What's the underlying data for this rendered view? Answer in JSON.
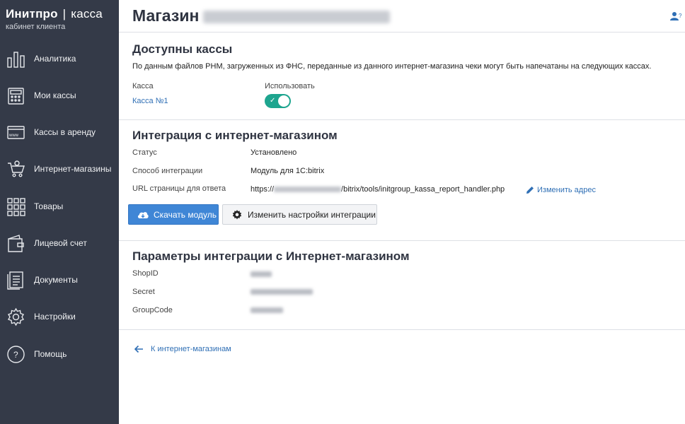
{
  "brand": {
    "name": "Инитпро",
    "separator": "|",
    "product": "касса",
    "subtitle": "кабинет клиента"
  },
  "sidebar": {
    "items": [
      {
        "label": "Аналитика",
        "icon": "bar-chart-icon"
      },
      {
        "label": "Мои кассы",
        "icon": "cash-register-icon"
      },
      {
        "label": "Кассы в аренду",
        "icon": "www-icon"
      },
      {
        "label": "Интернет-магазины",
        "icon": "shopping-cart-icon"
      },
      {
        "label": "Товары",
        "icon": "grid-icon"
      },
      {
        "label": "Лицевой счет",
        "icon": "wallet-icon"
      },
      {
        "label": "Документы",
        "icon": "documents-icon"
      },
      {
        "label": "Настройки",
        "icon": "gear-icon"
      },
      {
        "label": "Помощь",
        "icon": "help-circle-icon"
      }
    ]
  },
  "header": {
    "title": "Магазин"
  },
  "registers": {
    "title": "Доступны кассы",
    "description": "По данным файлов РНМ, загруженных из ФНС, переданные из данного интернет-магазина чеки могут быть напечатаны на следующих кассах.",
    "col_register": "Касса",
    "col_use": "Использовать",
    "register_name": "Касса №1",
    "use_enabled": true
  },
  "integration": {
    "title": "Интеграция с интернет-магазином",
    "status_label": "Статус",
    "status_value": "Установлено",
    "method_label": "Способ интеграции",
    "method_value": "Модуль для 1С:bitrix",
    "url_label": "URL страницы для ответа",
    "url_prefix": "https://",
    "url_suffix": "/bitrix/tools/initgroup_kassa_report_handler.php",
    "change_address": "Изменить адрес",
    "download_button": "Скачать модуль",
    "settings_button": "Изменить настройки интеграции"
  },
  "params": {
    "title": "Параметры интеграции с Интернет-магазином",
    "shopid_label": "ShopID",
    "secret_label": "Secret",
    "groupcode_label": "GroupCode"
  },
  "back_link": "К интернет-магазинам",
  "colors": {
    "sidebar": "#343a48",
    "accent": "#3f86d6",
    "toggle_on": "#1ea58f",
    "link": "#2f6fb5"
  }
}
